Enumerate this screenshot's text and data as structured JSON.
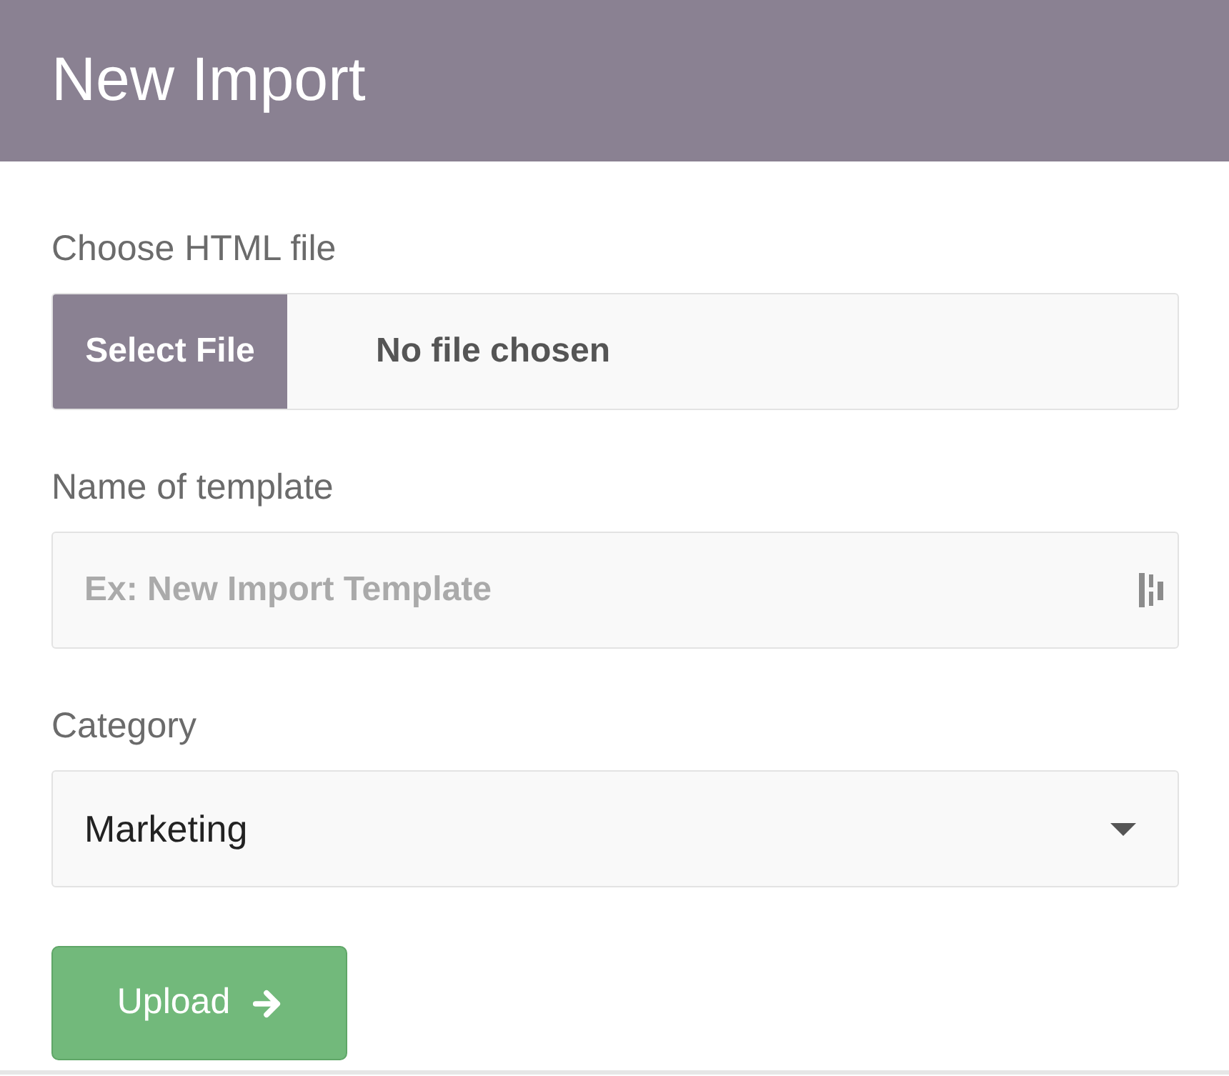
{
  "header": {
    "title": "New Import"
  },
  "fields": [
    {
      "kind": "file",
      "label": "Choose HTML file",
      "button": "Select File",
      "status": "No file chosen"
    },
    {
      "kind": "text",
      "label": "Name of template",
      "placeholder": "Ex: New Import Template"
    },
    {
      "kind": "select",
      "label": "Category",
      "value": "Marketing"
    }
  ],
  "submit": {
    "label": "Upload"
  }
}
